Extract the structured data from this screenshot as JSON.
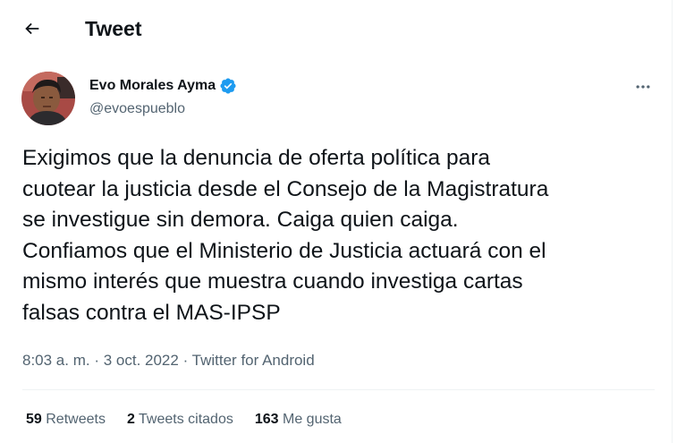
{
  "header": {
    "back_icon": "arrow-left-icon",
    "title": "Tweet"
  },
  "author": {
    "name": "Evo Morales Ayma",
    "handle": "@evoespueblo",
    "verified_icon": "verified-badge-icon",
    "verified_color": "#1d9bf0"
  },
  "more_icon": "more-horizontal-icon",
  "tweet": {
    "text": "Exigimos que la denuncia de oferta política para\ncuotear la justicia desde el Consejo de la Magistratura\nse investigue sin demora. Caiga quien caiga.\nConfiamos que el Ministerio de Justicia actuará con el\nmismo interés que muestra cuando investiga cartas\nfalsas contra el MAS-IPSP",
    "time": "8:03 a. m.",
    "separator": " · ",
    "date": "3 oct. 2022",
    "source": "Twitter for Android"
  },
  "stats": {
    "retweets_count": "59",
    "retweets_label": "Retweets",
    "quotes_count": "2",
    "quotes_label": "Tweets citados",
    "likes_count": "163",
    "likes_label": "Me gusta"
  },
  "colors": {
    "text_primary": "#0f1419",
    "text_secondary": "#536471",
    "divider": "#eff3f4",
    "accent": "#1d9bf0"
  }
}
